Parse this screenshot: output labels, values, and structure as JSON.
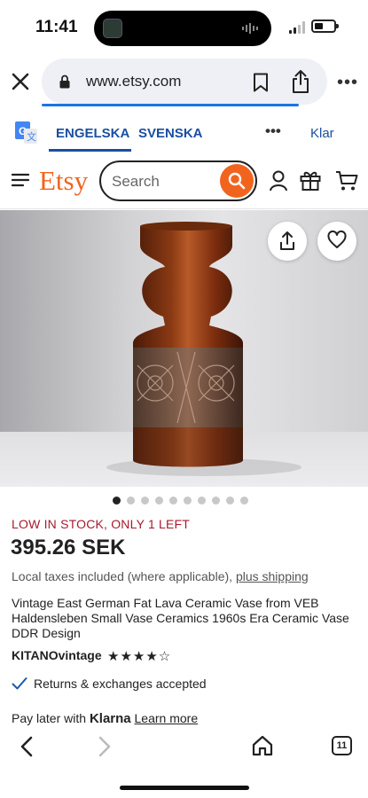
{
  "status_bar": {
    "time": "11:41",
    "battery_level": 0.45
  },
  "browser": {
    "url": "www.etsy.com",
    "icons": [
      "close-icon",
      "lock-icon",
      "bookmark-icon",
      "share-icon",
      "more-icon"
    ]
  },
  "translate": {
    "active_language": "ENGELSKA",
    "other_language": "SVENSKA",
    "more_label": "•••",
    "done_label": "Klar"
  },
  "etsy": {
    "logo": "Etsy",
    "search_placeholder": "Search",
    "brand_color": "#f1641e",
    "icons": [
      "menu-icon",
      "search-icon",
      "user-icon",
      "gift-icon",
      "cart-icon"
    ]
  },
  "gallery": {
    "image_count": 10,
    "active_index": 0
  },
  "product": {
    "stock_notice": "LOW IN STOCK, ONLY 1 LEFT",
    "price": "395.26 SEK",
    "tax_text": "Local taxes included (where applicable), ",
    "shipping_link": "plus shipping",
    "title": "Vintage East German Fat Lava Ceramic Vase from VEB Haldensleben Small Vase Ceramics 1960s Era Ceramic Vase DDR Design",
    "seller": "KITANOvintage",
    "rating": 4.5,
    "stars": "★★★★☆",
    "returns": "Returns & exchanges accepted",
    "pay_later_prefix": "Pay later with ",
    "pay_later_brand": "Klarna",
    "learn_more": "Learn more"
  },
  "toolbar": {
    "tab_count": "11"
  }
}
